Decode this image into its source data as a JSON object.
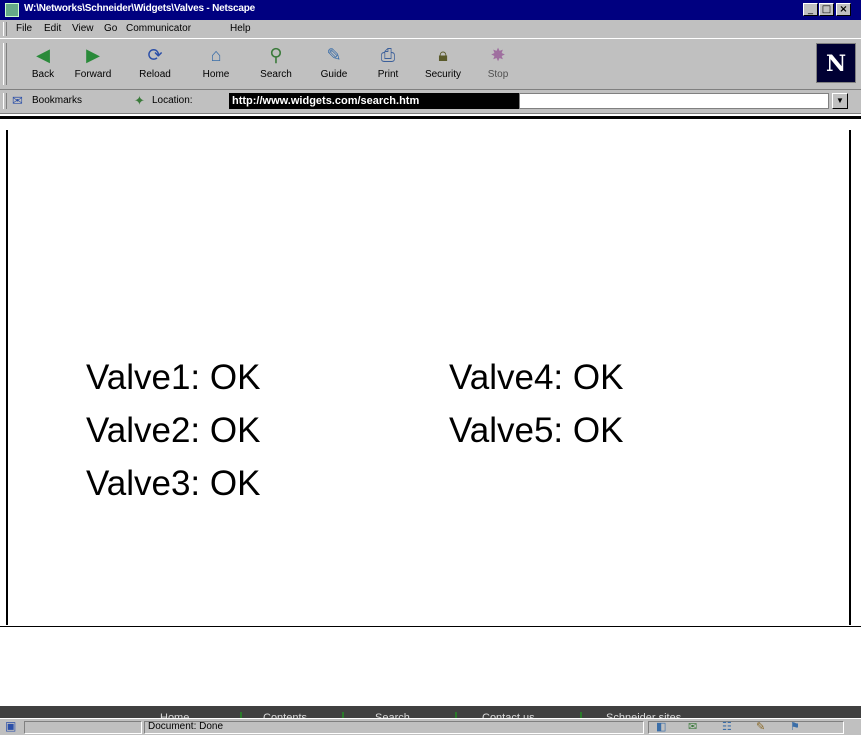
{
  "window": {
    "title": "W:\\Networks\\Schneider\\Widgets\\Valves - Netscape"
  },
  "menu": {
    "items": [
      "File",
      "Edit",
      "View",
      "Go",
      "Communicator",
      "Help"
    ]
  },
  "toolbar": {
    "buttons": [
      {
        "label": "Back",
        "icon": "back-arrow-icon"
      },
      {
        "label": "Forward",
        "icon": "forward-arrow-icon"
      },
      {
        "label": "Reload",
        "icon": "reload-icon"
      },
      {
        "label": "Home",
        "icon": "home-icon"
      },
      {
        "label": "Search",
        "icon": "search-icon"
      },
      {
        "label": "Guide",
        "icon": "guide-icon"
      },
      {
        "label": "Print",
        "icon": "print-icon"
      },
      {
        "label": "Security",
        "icon": "security-icon"
      },
      {
        "label": "Stop",
        "icon": "stop-icon"
      }
    ],
    "logo_letter": "N"
  },
  "location_bar": {
    "bookmarks_label": "Bookmarks",
    "location_label": "Location:",
    "url": "http://www.widgets.com/search.htm"
  },
  "content": {
    "valves_left": [
      "Valve1: OK",
      "Valve2: OK",
      "Valve3: OK"
    ],
    "valves_right": [
      "Valve4: OK",
      "Valve5: OK"
    ]
  },
  "footer_nav": {
    "items": [
      "Home",
      "Contents",
      "Search",
      "Contact us",
      "Schneider sites"
    ],
    "separator_color": "#2a7a2a"
  },
  "status_bar": {
    "text": "Document: Done"
  },
  "colors": {
    "titlebar": "#000080",
    "chrome": "#c0c0c0",
    "footer_nav_bg": "#404040"
  }
}
